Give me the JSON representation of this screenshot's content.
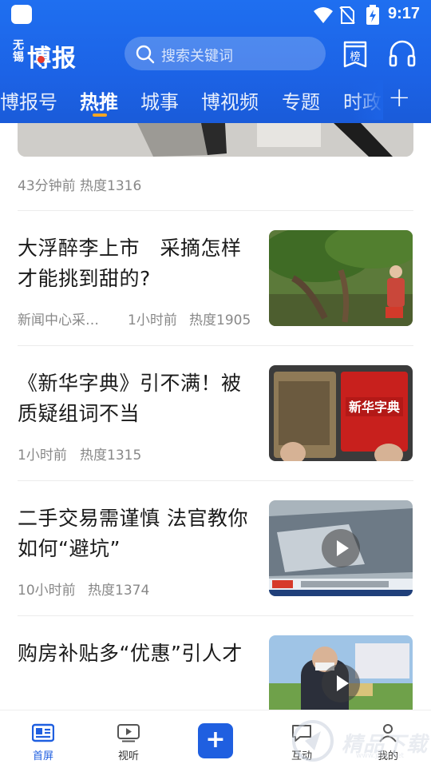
{
  "status_bar": {
    "time": "9:17"
  },
  "header": {
    "logo_small": "无锡",
    "logo_big": "博报",
    "search_placeholder": "搜索关键词",
    "rank_label": "榜"
  },
  "tabs": [
    {
      "label": "博报号",
      "active": false
    },
    {
      "label": "热推",
      "active": true
    },
    {
      "label": "城事",
      "active": false
    },
    {
      "label": "博视频",
      "active": false
    },
    {
      "label": "专题",
      "active": false
    },
    {
      "label": "时政",
      "active": false
    }
  ],
  "feed": {
    "top_item_meta": "43分钟前   热度1316",
    "articles": [
      {
        "title": "大浮醉李上市　采摘怎样才能挑到甜的?",
        "source": "新闻中心采…",
        "time": "1小时前",
        "heat": "热度1905",
        "has_video": false
      },
      {
        "title": "《新华字典》引不满！被质疑组词不当",
        "source": "",
        "time": "1小时前",
        "heat": "热度1315",
        "has_video": false,
        "image_text": "新华字典"
      },
      {
        "title": "二手交易需谨慎 法官教你如何“避坑”",
        "source": "",
        "time": "10小时前",
        "heat": "热度1374",
        "has_video": true
      },
      {
        "title": "购房补贴多“优惠”引人才",
        "source": "",
        "time": "",
        "heat": "",
        "has_video": true
      }
    ]
  },
  "bottom_nav": [
    {
      "label": "首屏",
      "active": true
    },
    {
      "label": "视听",
      "active": false
    },
    {
      "label": "+",
      "active": false
    },
    {
      "label": "互动",
      "active": false
    },
    {
      "label": "我的",
      "active": false
    }
  ],
  "watermark": {
    "text": "精品下载",
    "sub": "www.jpxz.net"
  },
  "colors": {
    "brand_blue": "#1f6ff0",
    "tab_indicator": "#f5a623",
    "active_nav": "#1f5fe0"
  }
}
